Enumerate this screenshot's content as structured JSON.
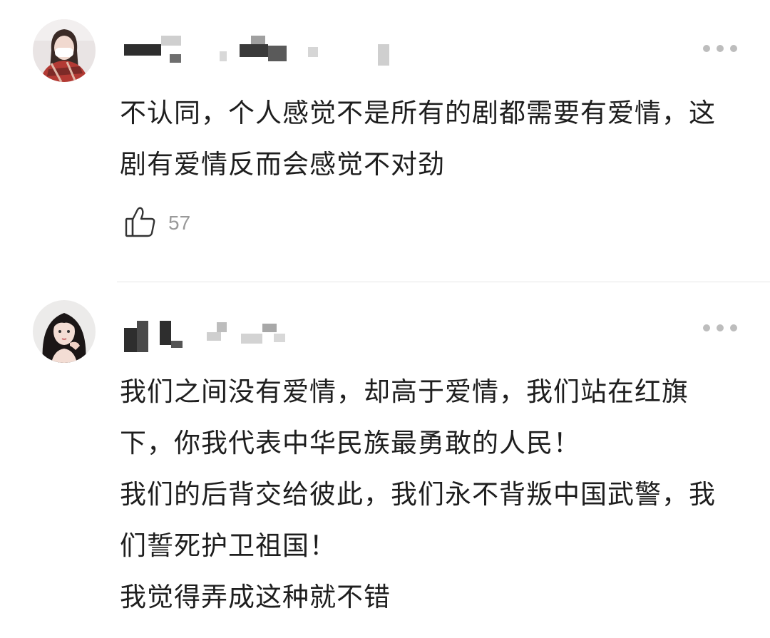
{
  "comments": [
    {
      "avatar_icon": "user-avatar-masked-woman",
      "username_hidden": true,
      "text": "不认同，个人感觉不是所有的剧都需要有爱情，这剧有爱情反而会感觉不对劲",
      "like_icon": "thumbs-up-icon",
      "likes": "57",
      "more_icon": "more-dots-icon"
    },
    {
      "avatar_icon": "user-avatar-woman-hand-on-cheek",
      "username_hidden": true,
      "lines": [
        "我们之间没有爱情，却高于爱情，我们站在红旗下，你我代表中华民族最勇敢的人民！",
        "我们的后背交给彼此，我们永不背叛中国武警，我们誓死护卫祖国！",
        "我觉得弄成这种就不错"
      ],
      "more_icon": "more-dots-icon"
    }
  ],
  "colors": {
    "text": "#1e1e1e",
    "meta": "#999999",
    "dots": "#bdbdbd",
    "divider": "#e6e6e6"
  }
}
